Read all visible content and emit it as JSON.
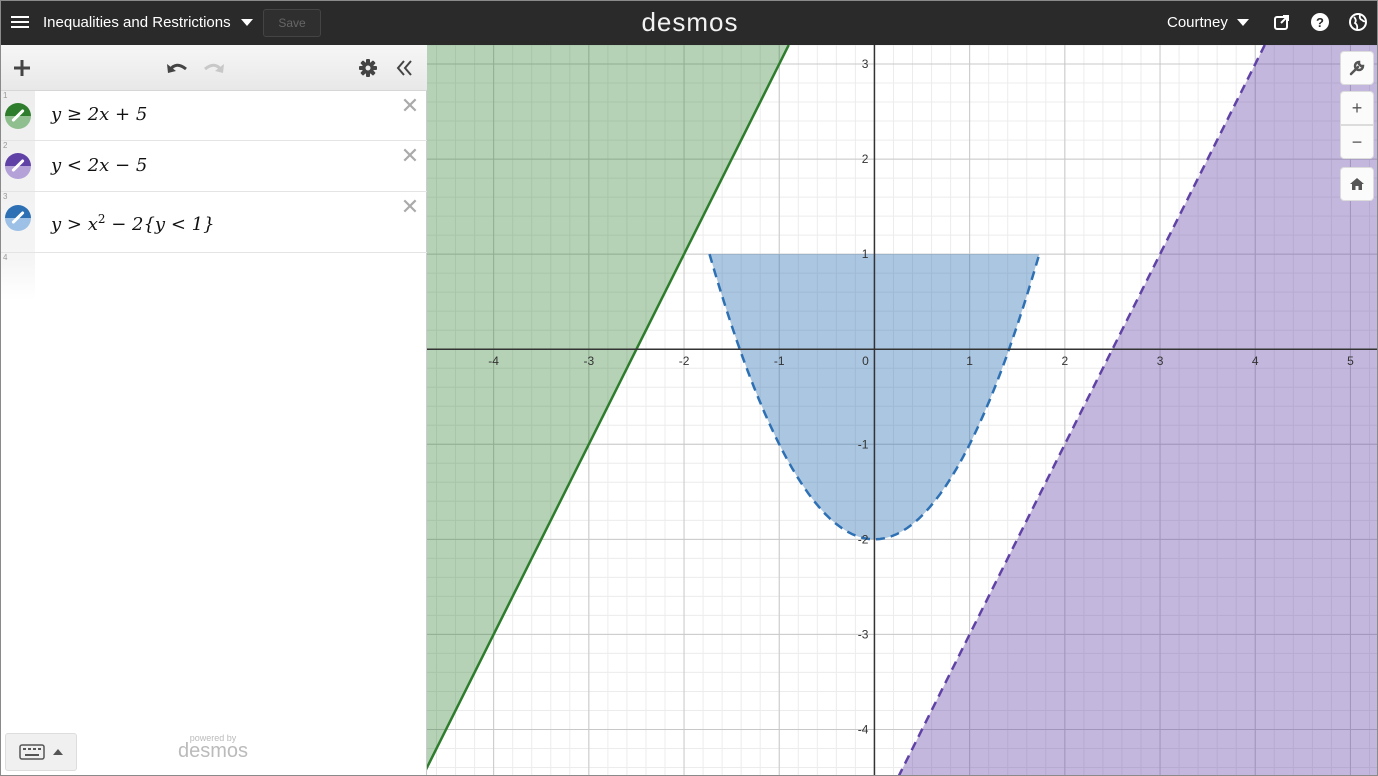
{
  "header": {
    "graph_title": "Inequalities and Restrictions",
    "save_label": "Save",
    "logo": "desmos",
    "user_name": "Courtney"
  },
  "expressions": [
    {
      "index": "1",
      "latex": "y ≥ 2x + 5",
      "color": "#2d7d2d"
    },
    {
      "index": "2",
      "latex": "y < 2x − 5",
      "color": "#6042a6"
    },
    {
      "index": "3",
      "latex_pre": "y > x",
      "latex_sup": "2",
      "latex_post": " − 2{y < 1}",
      "color": "#2d70b3"
    },
    {
      "index": "4"
    }
  ],
  "delete_symbol": "✕",
  "powered_by": {
    "line1": "powered by",
    "line2": "desmos"
  },
  "graph": {
    "x_range": [
      -4.7,
      5.3
    ],
    "y_range": [
      -4.5,
      3.2
    ],
    "x_tick_labels": [
      "-4",
      "-3",
      "-2",
      "-1",
      "0",
      "1",
      "2",
      "3",
      "4",
      "5"
    ],
    "y_tick_labels": [
      "3",
      "2",
      "1",
      "-1",
      "-2",
      "-3",
      "-4"
    ],
    "colors": {
      "green": "#2d7d2d",
      "purple": "#6042a6",
      "blue": "#2d70b3"
    }
  },
  "controls": {
    "zoom_in": "+",
    "zoom_out": "−"
  },
  "icons": [
    "menu-icon",
    "caret-down-icon",
    "share-icon",
    "help-icon",
    "globe-icon",
    "add-icon",
    "undo-icon",
    "redo-icon",
    "gear-icon",
    "collapse-icon",
    "keyboard-icon",
    "wrench-icon",
    "home-icon"
  ]
}
